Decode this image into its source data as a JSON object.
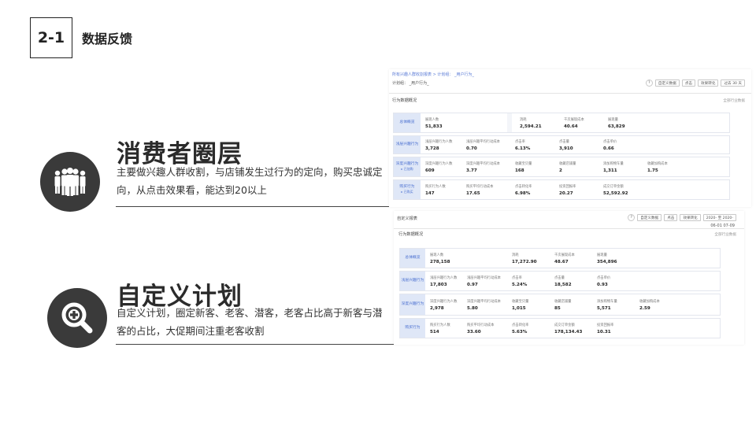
{
  "header": {
    "badge": "2-1",
    "title": "数据反馈"
  },
  "section1": {
    "title": "消费者圈层",
    "desc": "主要做兴趣人群收割，与店铺发生过行为的定向，购买忠诚定向，从点击效果看，能达到20以上",
    "icon": "people-group-icon"
  },
  "section2": {
    "title": "自定义计划",
    "desc": "自定义计划，圈定新客、老客、潜客，老客占比高于新客与潜客的占比，大促期间注重老客收割",
    "icon": "magnify-plus-icon"
  },
  "shot1": {
    "breadcrumb": "所有兴趣人群收割报表 > 计划组：  _用户行为_",
    "breadcrumb2": "计划组：  _用户行为_",
    "controls": [
      "自定义数据",
      "点击",
      "效果转化",
      "过去 30 天"
    ],
    "section_title": "行为数据概况",
    "section_right": "全部行业数据",
    "rows": [
      {
        "label": "总体概览",
        "sub": "",
        "g1": [
          {
            "k": "展现人数",
            "v": "51,833"
          }
        ],
        "g2": [
          {
            "k": "消耗",
            "v": "2,594.21"
          },
          {
            "k": "千次展现成本",
            "v": "40.64"
          },
          {
            "k": "展现量",
            "v": "63,829"
          }
        ]
      },
      {
        "label": "浅层兴趣行为",
        "sub": "",
        "g1": [
          {
            "k": "浅层兴趣行为人数",
            "v": "3,728"
          },
          {
            "k": "浅层兴趣平均行动成本",
            "v": "0.70"
          }
        ],
        "g2": [
          {
            "k": "点击率",
            "v": "6.13%"
          },
          {
            "k": "点击量",
            "v": "3,910"
          },
          {
            "k": "点击单价",
            "v": "0.66"
          }
        ]
      },
      {
        "label": "深度兴趣行为",
        "sub": "▸ 已加购",
        "g1": [
          {
            "k": "深度兴趣行为人数",
            "v": "609"
          },
          {
            "k": "深度兴趣平均行动成本",
            "v": "3.77"
          }
        ],
        "g2": [
          {
            "k": "收藏宝贝量",
            "v": "168"
          },
          {
            "k": "收藏店铺量",
            "v": "2"
          },
          {
            "k": "添加购物车量",
            "v": "1,311"
          },
          {
            "k": "收藏加购成本",
            "v": "1.75"
          }
        ]
      },
      {
        "label": "购买行为",
        "sub": "▸ 已购买",
        "g1": [
          {
            "k": "购买行为人数",
            "v": "147"
          },
          {
            "k": "购买平均行动成本",
            "v": "17.65"
          }
        ],
        "g2": [
          {
            "k": "点击转化率",
            "v": "6.98%"
          },
          {
            "k": "投资回报率",
            "v": "20.27"
          },
          {
            "k": "成交订单金额",
            "v": "52,592.92"
          }
        ]
      }
    ]
  },
  "shot2": {
    "header": "自定义报表",
    "controls": [
      "自定义数据",
      "点击",
      "效果转化",
      "2020-  至 2020-"
    ],
    "dates": "06-01   07-09",
    "section_title": "行为数据概况",
    "section_right": "全部行业数据",
    "rows": [
      {
        "label": "总体概览",
        "sub": "",
        "g1": [
          {
            "k": "展现人数",
            "v": "278,158"
          }
        ],
        "g2": [
          {
            "k": "消耗",
            "v": "17,272.90"
          },
          {
            "k": "千次展现成本",
            "v": "48.67"
          },
          {
            "k": "展现量",
            "v": "354,896"
          }
        ]
      },
      {
        "label": "浅层兴趣行为",
        "sub": "",
        "g1": [
          {
            "k": "浅层兴趣行为人数",
            "v": "17,803"
          },
          {
            "k": "浅层兴趣平均行动成本",
            "v": "0.97"
          }
        ],
        "g2": [
          {
            "k": "点击率",
            "v": "5.24%"
          },
          {
            "k": "点击量",
            "v": "18,582"
          },
          {
            "k": "点击单价",
            "v": "0.93"
          }
        ]
      },
      {
        "label": "深度兴趣行为",
        "sub": "",
        "g1": [
          {
            "k": "深度兴趣行为人数",
            "v": "2,978"
          },
          {
            "k": "深度兴趣平均行动成本",
            "v": "5.80"
          }
        ],
        "g2": [
          {
            "k": "收藏宝贝量",
            "v": "1,015"
          },
          {
            "k": "收藏店铺量",
            "v": "85"
          },
          {
            "k": "添加购物车量",
            "v": "5,571"
          },
          {
            "k": "收藏加购成本",
            "v": "2.59"
          }
        ]
      },
      {
        "label": "购买行为",
        "sub": "",
        "g1": [
          {
            "k": "购买行为人数",
            "v": "514"
          },
          {
            "k": "购买平均行动成本",
            "v": "33.60"
          }
        ],
        "g2": [
          {
            "k": "点击转化率",
            "v": "5.63%"
          },
          {
            "k": "成交订单金额",
            "v": "178,134.43"
          },
          {
            "k": "投资回报率",
            "v": "10.31"
          }
        ]
      }
    ]
  }
}
